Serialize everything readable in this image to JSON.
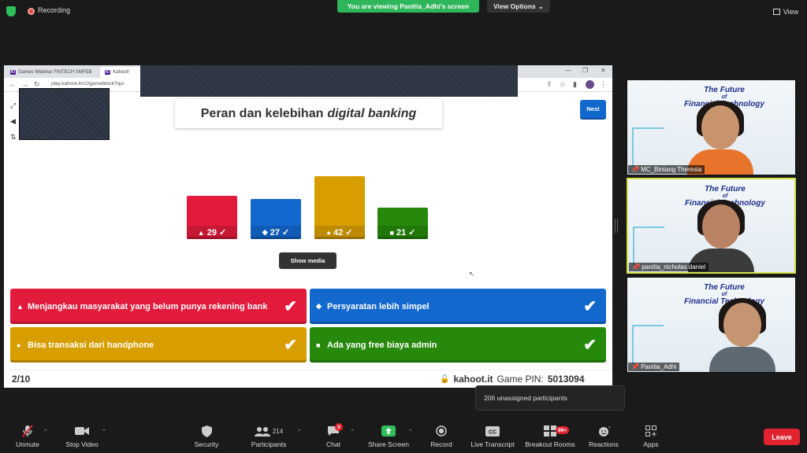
{
  "zoom": {
    "recording_label": "Recording",
    "viewing_banner": "You are viewing Panitia_Adhi's screen",
    "view_options_label": "View Options",
    "view_label": "View",
    "tooltip": "206 unassigned participants",
    "leave_label": "Leave",
    "toolbar": {
      "unmute": "Unmute",
      "stop_video": "Stop Video",
      "security": "Security",
      "participants": "Participants",
      "participants_count": "214",
      "chat": "Chat",
      "chat_badge": "3",
      "share_screen": "Share Screen",
      "record": "Record",
      "live_transcript": "Live Transcript",
      "breakout_rooms": "Breakout Rooms",
      "breakout_badge": "99+",
      "reactions": "Reactions",
      "apps": "Apps"
    }
  },
  "browser": {
    "tab1": "Games Webinar FINTECH SMFEB",
    "tab2": "Kahoot!",
    "url": "play.kahoot.it/v2/gameblock?qui"
  },
  "kahoot": {
    "question_prefix": "Peran dan kelebihan",
    "question_emphasis": "digital banking",
    "next_label": "Next",
    "show_media_label": "Show media",
    "results": [
      {
        "shape": "▲",
        "count": 29,
        "color": "#e21b3c"
      },
      {
        "shape": "◆",
        "count": 27,
        "color": "#1368ce"
      },
      {
        "shape": "●",
        "count": 42,
        "color": "#d89e00"
      },
      {
        "shape": "■",
        "count": 21,
        "color": "#26890c"
      }
    ],
    "answers": [
      {
        "shape": "▲",
        "text": "Menjangkau masyarakat yang belum punya rekening bank",
        "color": "#e21b3c"
      },
      {
        "shape": "◆",
        "text": "Persyaratan lebih simpel",
        "color": "#1368ce"
      },
      {
        "shape": "●",
        "text": "Bisa transaksi dari handphone",
        "color": "#d89e00"
      },
      {
        "shape": "■",
        "text": "Ada yang free biaya admin",
        "color": "#26890c"
      }
    ],
    "progress": "2/10",
    "site": "kahoot.it",
    "pin_label": "Game PIN:",
    "pin": "5013094"
  },
  "participants": [
    {
      "name": "MC_Bintang Theresia",
      "title_l1": "The Future",
      "title_l2": "of",
      "title_l3": "Financial Technology"
    },
    {
      "name": "panitia_nicholas daniel",
      "title_l1": "The Future",
      "title_l2": "of",
      "title_l3": "Financial Technology"
    },
    {
      "name": "Panitia_Adhi",
      "title_l1": "The Future",
      "title_l2": "of",
      "title_l3": "Financial Technology"
    }
  ]
}
